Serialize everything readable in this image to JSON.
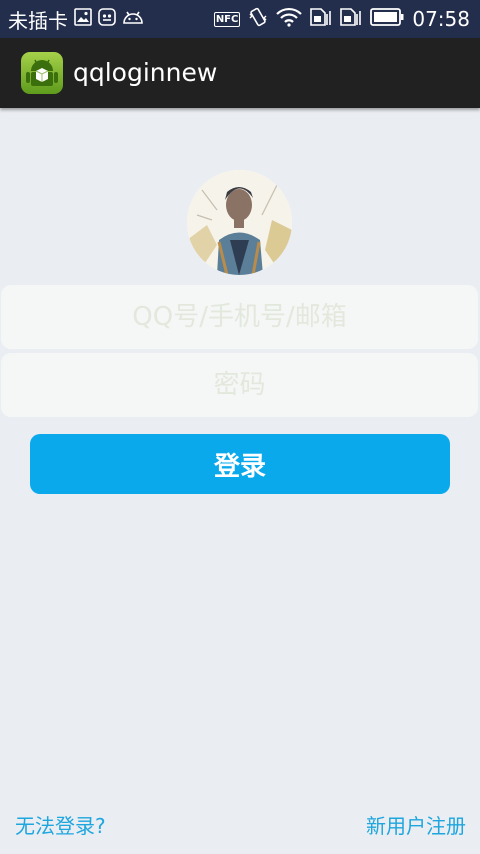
{
  "status_bar": {
    "carrier": "未插卡",
    "nfc_label": "NFC",
    "time": "07:58",
    "icons": [
      "image-icon",
      "notification-icon",
      "android-debug-icon",
      "nfc-icon",
      "vibrate-icon",
      "wifi-icon",
      "sim-icon",
      "sim-icon",
      "battery-icon"
    ],
    "background": "#232e4d"
  },
  "action_bar": {
    "title": "qqloginnew",
    "icon": "android-app-icon",
    "background": "#212121"
  },
  "login_form": {
    "account_placeholder": "QQ号/手机号/邮箱",
    "password_placeholder": "密码",
    "login_label": "登录",
    "accent_color": "#0aa9ec"
  },
  "footer": {
    "forgot_label": "无法登录?",
    "register_label": "新用户注册",
    "link_color": "#1ea6de"
  }
}
